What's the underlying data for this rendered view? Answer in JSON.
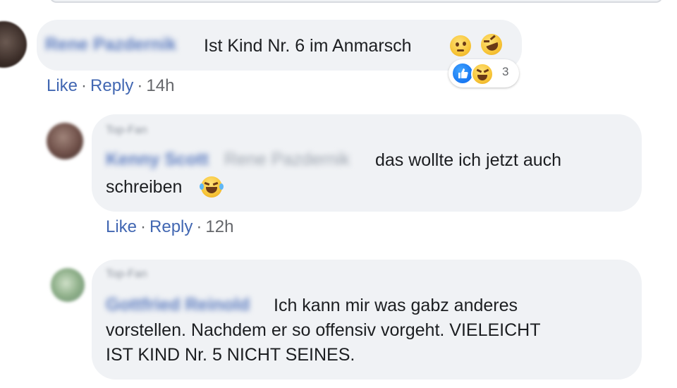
{
  "comment": {
    "author": "Rene Pazdernik",
    "text": "Ist Kind Nr. 6 im Anmarsch",
    "emojis": [
      "thinking-emoji",
      "rolling-laughing-emoji"
    ],
    "reactions": {
      "types": [
        "like",
        "haha"
      ],
      "count": "3"
    },
    "actions": {
      "like": "Like",
      "separator": "·",
      "reply": "Reply",
      "time": "14h"
    }
  },
  "replies": [
    {
      "badge": "Top-Fan",
      "author": "Kenny Scott",
      "mention": "Rene Pazdernik",
      "text_line1": "das wollte ich jetzt auch",
      "text_line2": "schreiben",
      "emoji": "laughing-tears-emoji",
      "actions": {
        "like": "Like",
        "separator": "·",
        "reply": "Reply",
        "time": "12h"
      }
    },
    {
      "badge": "Top-Fan",
      "author": "Gottfried Reinold",
      "text_line1": "Ich kann mir was gabz anderes",
      "text_line2": "vorstellen. Nachdem er so offensiv vorgeht. VIELEICHT",
      "text_line3": "IST KIND Nr. 5 NICHT SEINES."
    }
  ],
  "colors": {
    "link": "#4267b2",
    "bubble": "#f0f2f5",
    "meta": "#65676b",
    "like_blue": "#1877f2"
  }
}
